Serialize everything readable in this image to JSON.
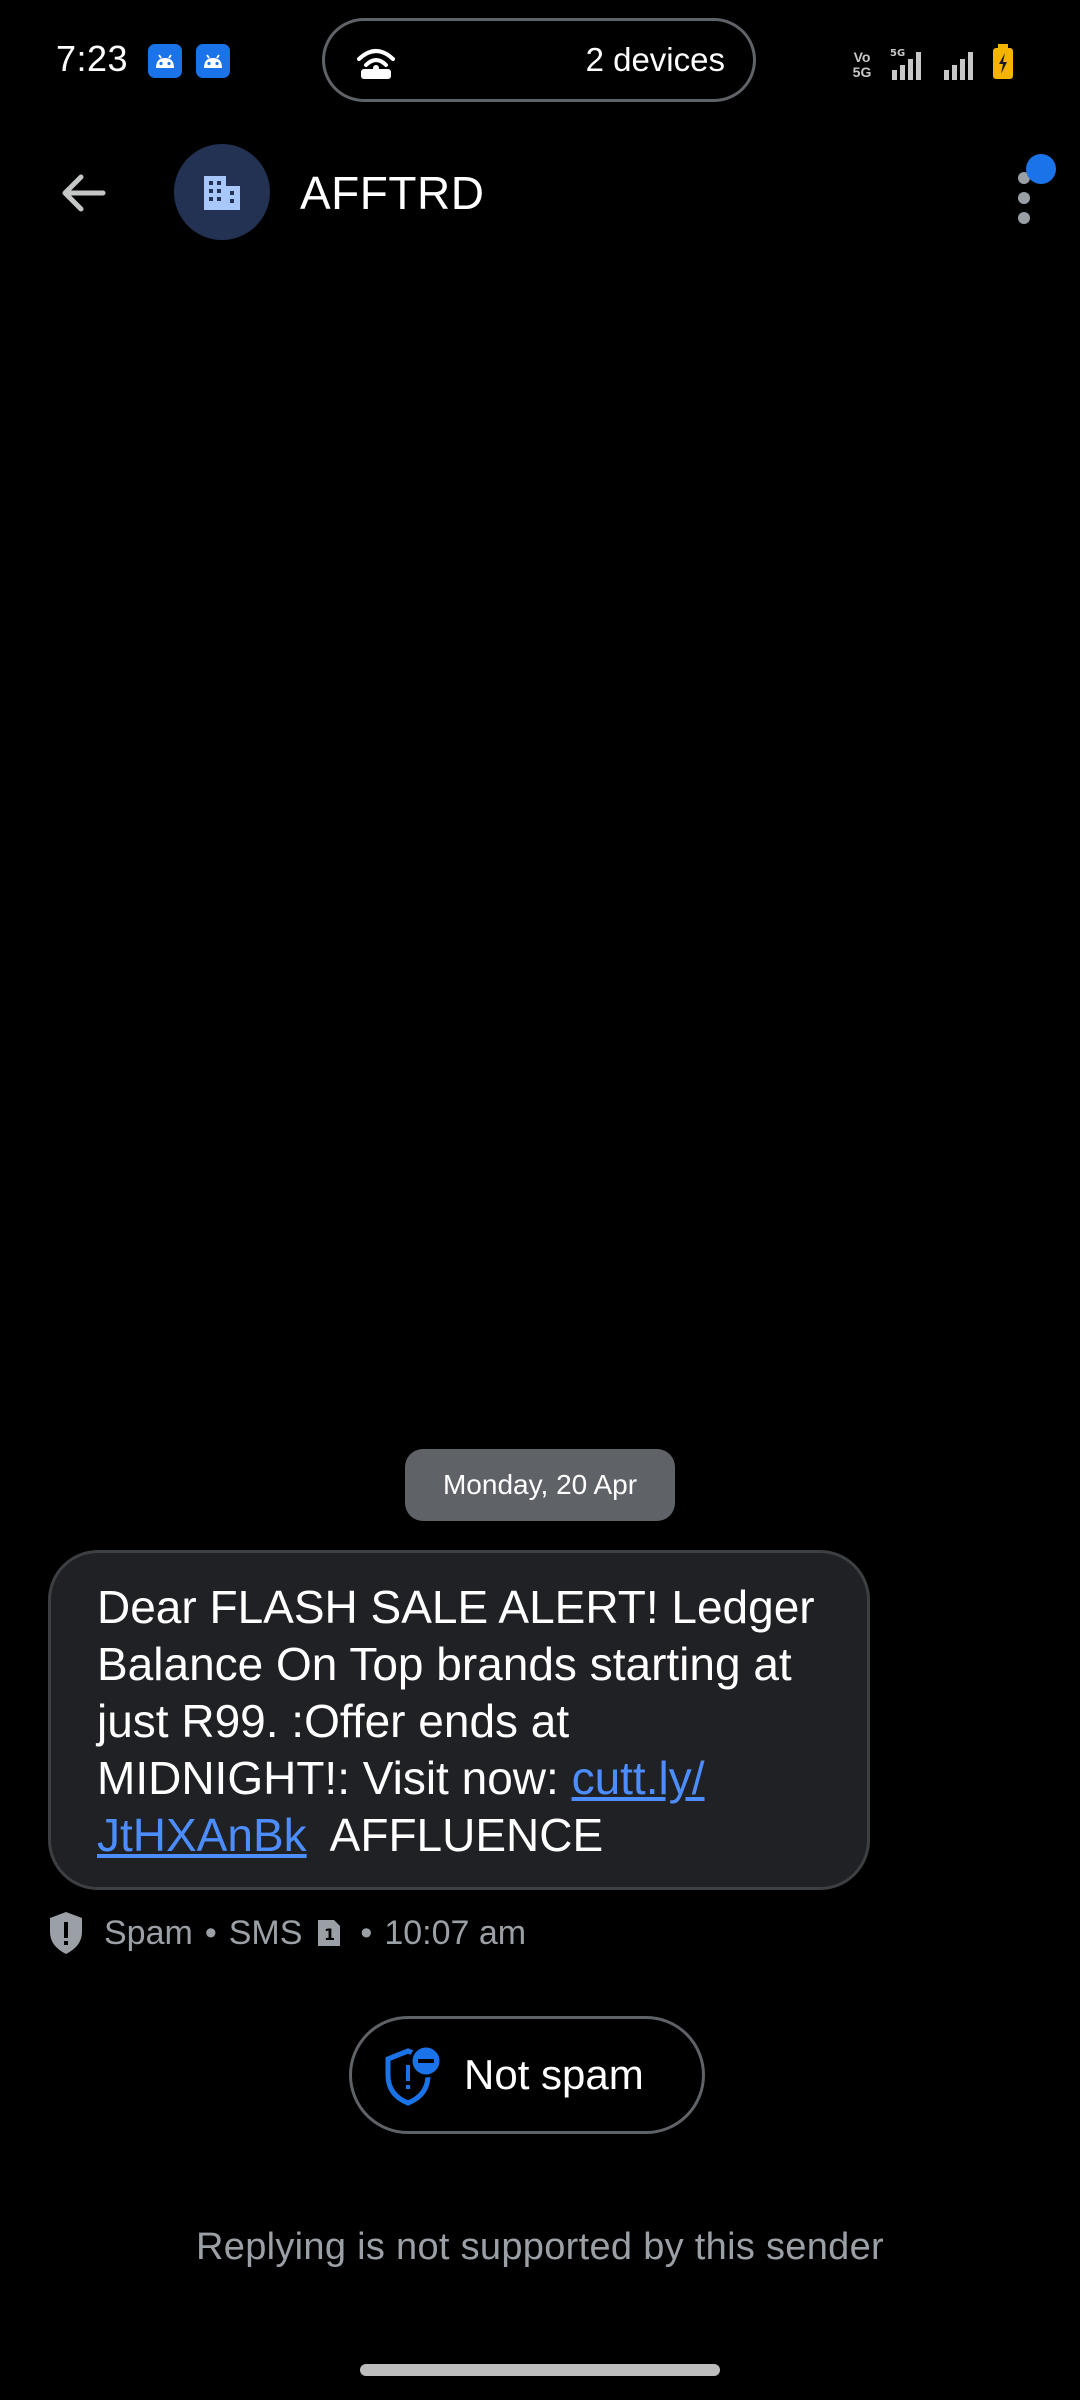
{
  "status_bar": {
    "time": "7:23",
    "hotspot_devices": "2 devices",
    "volte_label_top": "Vo",
    "volte_label_bottom": "5G",
    "network_type": "5G"
  },
  "header": {
    "contact_name": "AFFTRD",
    "avatar_icon": "building-icon",
    "back_icon": "arrow-left-icon",
    "menu_icon": "more-vert-icon"
  },
  "conversation": {
    "date_label": "Monday, 20 Apr",
    "message": {
      "text_before_link": "Dear FLASH SALE ALERT! Ledger Balance On Top brands starting at just R99. :Offer ends at MIDNIGHT!: Visit now: ",
      "link_line1": "cutt.ly/",
      "link_line2": "JtHXAnBk",
      "text_after_link": "AFFLUENCE"
    },
    "meta": {
      "category": "Spam",
      "channel": "SMS",
      "sim": "1",
      "time": "10:07 am"
    }
  },
  "actions": {
    "not_spam_label": "Not spam"
  },
  "footer": {
    "reply_note": "Replying is not supported by this sender"
  },
  "colors": {
    "background": "#000000",
    "bubble": "#202124",
    "accent": "#1a73e8",
    "link": "#4c8dff",
    "secondary_text": "#9aa0a6"
  }
}
